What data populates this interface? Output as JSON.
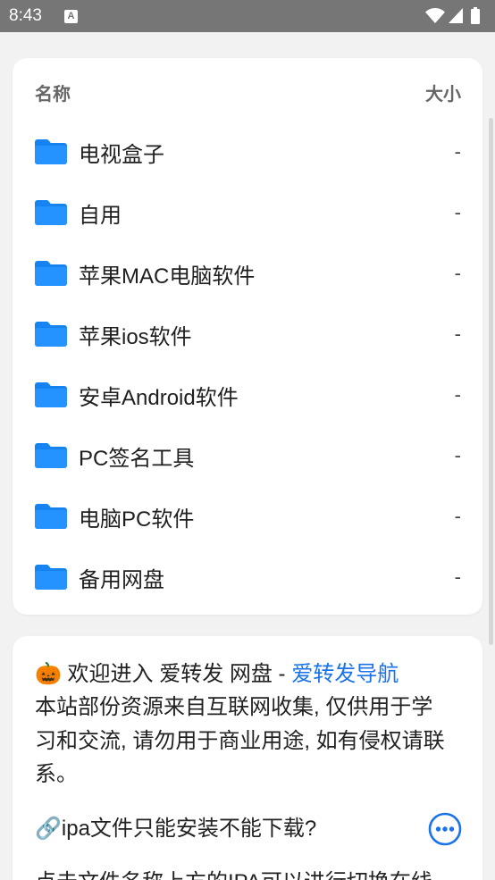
{
  "colors": {
    "status_bar": "#767676",
    "page_background": "#f2f2f2",
    "accent": "#1a73e8",
    "folder": "#2492ff",
    "folder_back": "#1684f0"
  },
  "status_bar": {
    "time": "8:43",
    "notification_letter": "A",
    "icons": {
      "notification": "a-letter-icon",
      "wifi": "wifi-icon",
      "signal": "signal-icon",
      "battery": "battery-icon"
    }
  },
  "file_list": {
    "columns": {
      "name": "名称",
      "size": "大小"
    },
    "items": [
      {
        "name": "电视盒子",
        "size": "-",
        "icon": "folder-icon"
      },
      {
        "name": "自用",
        "size": "-",
        "icon": "folder-icon"
      },
      {
        "name": "苹果MAC电脑软件",
        "size": "-",
        "icon": "folder-icon"
      },
      {
        "name": "苹果ios软件",
        "size": "-",
        "icon": "folder-icon"
      },
      {
        "name": "安卓Android软件",
        "size": "-",
        "icon": "folder-icon"
      },
      {
        "name": "PC签名工具",
        "size": "-",
        "icon": "folder-icon"
      },
      {
        "name": "电脑PC软件",
        "size": "-",
        "icon": "folder-icon"
      },
      {
        "name": "备用网盘",
        "size": "-",
        "icon": "folder-icon"
      }
    ]
  },
  "readme": {
    "welcome_prefix": "🎃 欢迎进入 爱转发 网盘 - ",
    "welcome_link": "爱转发导航",
    "disclaimer": "本站部份资源来自互联网收集, 仅供用于学习和交流, 请勿用于商业用途, 如有侵权请联系。",
    "faq_question": "🔗ipa文件只能安装不能下载?",
    "faq_more_icon": "more-horizontal-icon",
    "faq_answer": "点击文件名称上方的IPA可以进行切换在线"
  }
}
